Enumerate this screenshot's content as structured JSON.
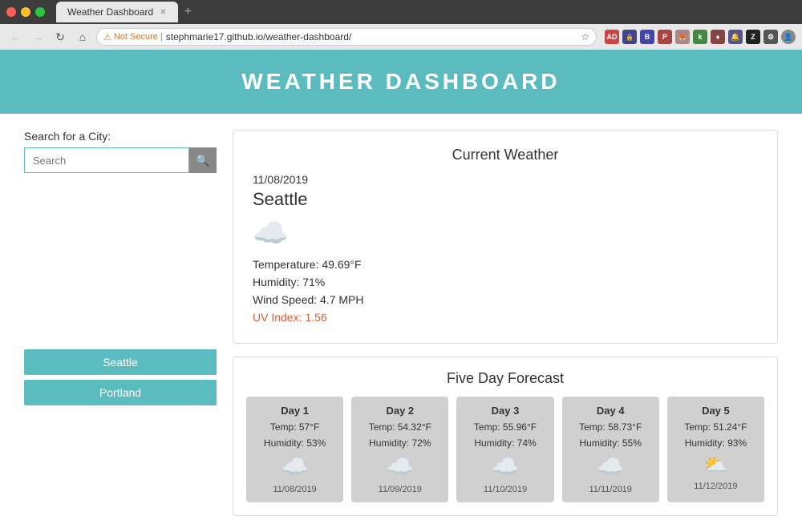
{
  "browser": {
    "tab_title": "Weather Dashboard",
    "url": "stephmarie17.github.io/weather-dashboard/",
    "security_label": "Not Secure",
    "new_tab_icon": "+"
  },
  "header": {
    "title": "WEATHER DASHBOARD"
  },
  "search": {
    "label": "Search for a City:",
    "placeholder": "Search",
    "button_icon": "🔍"
  },
  "saved_cities": [
    {
      "name": "Seattle"
    },
    {
      "name": "Portland"
    }
  ],
  "current_weather": {
    "title": "Current Weather",
    "date": "11/08/2019",
    "city": "Seattle",
    "icon": "cloud",
    "temperature": "Temperature: 49.69°F",
    "humidity": "Humidity: 71%",
    "wind_speed": "Wind Speed: 4.7 MPH",
    "uv_index": "UV Index: 1.56"
  },
  "forecast": {
    "title": "Five Day Forecast",
    "days": [
      {
        "label": "Day 1",
        "temp": "Temp: 57°F",
        "humidity": "Humidity: 53%",
        "icon": "cloud",
        "date": "11/08/2019"
      },
      {
        "label": "Day 2",
        "temp": "Temp: 54.32°F",
        "humidity": "Humidity: 72%",
        "icon": "cloud",
        "date": "11/09/2019"
      },
      {
        "label": "Day 3",
        "temp": "Temp: 55.96°F",
        "humidity": "Humidity: 74%",
        "icon": "cloud",
        "date": "11/10/2019"
      },
      {
        "label": "Day 4",
        "temp": "Temp: 58.73°F",
        "humidity": "Humidity: 55%",
        "icon": "cloud",
        "date": "11/11/2019"
      },
      {
        "label": "Day 5",
        "temp": "Temp: 51.24°F",
        "humidity": "Humidity: 93%",
        "icon": "sun-cloud",
        "date": "11/12/2019"
      }
    ]
  }
}
